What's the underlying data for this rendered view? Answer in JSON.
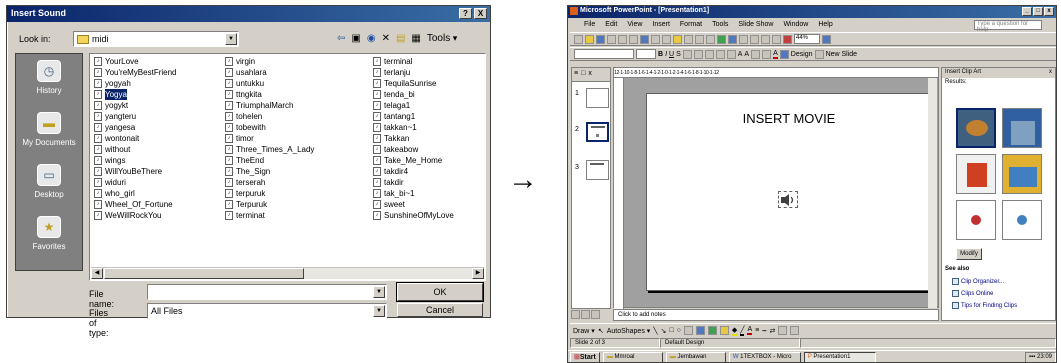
{
  "dialog": {
    "title": "Insert Sound",
    "look_in_label": "Look in:",
    "look_in_value": "midi",
    "tools_label": "Tools",
    "places": [
      {
        "label": "History",
        "icon": "history-icon"
      },
      {
        "label": "My Documents",
        "icon": "my-documents-icon"
      },
      {
        "label": "Desktop",
        "icon": "desktop-icon"
      },
      {
        "label": "Favorites",
        "icon": "favorites-icon"
      }
    ],
    "files_col1": [
      "YourLove",
      "You'reMyBestFriend",
      "yogyah",
      "Yogya",
      "yogykt",
      "yangteru",
      "yangesa",
      "wontonait",
      "without",
      "wings",
      "WillYouBeThere",
      "widuri",
      "who_girl",
      "Wheel_Of_Fortune",
      "WeWillRockYou"
    ],
    "files_col2": [
      "virgin",
      "usahlara",
      "untukku",
      "ttngkita",
      "TriumphalMarch",
      "tohelen",
      "tobewith",
      "timor",
      "Three_Times_A_Lady",
      "TheEnd",
      "The_Sign",
      "terserah",
      "terpuruk",
      "Terpuruk",
      "terminat"
    ],
    "files_col3": [
      "terminal",
      "terlanju",
      "TequilaSunrise",
      "tenda_bi",
      "telaga1",
      "tantang1",
      "takkan~1",
      "Takkan",
      "takeabow",
      "Take_Me_Home",
      "takdir4",
      "takdir",
      "tak_bi~1",
      "sweet",
      "SunshineOfMyLove"
    ],
    "selected_file": "Yogya",
    "file_name_label": "File name:",
    "file_name_value": "",
    "files_of_type_label": "Files of type:",
    "files_of_type_value": "All Files",
    "ok_label": "OK",
    "cancel_label": "Cancel",
    "help_btn": "?",
    "close_btn": "X"
  },
  "arrow": "→",
  "ppt": {
    "title": "Microsoft PowerPoint - [Presentation1]",
    "menu": [
      "File",
      "Edit",
      "View",
      "Insert",
      "Format",
      "Tools",
      "Slide Show",
      "Window",
      "Help"
    ],
    "ask_placeholder": "Type a question for help",
    "zoom": "44%",
    "design_label": "Design",
    "new_slide_label": "New Slide",
    "slide_title": "INSERT MOVIE",
    "slide_numbers": [
      "1",
      "2",
      "3"
    ],
    "notes_placeholder": "Click to add notes",
    "ruler_text": "12·1·10·1·8·1·6·1·4·1·2·1·0·1·2·1·4·1·6·1·8·1·10·1·12",
    "draw_label": "Draw",
    "autoshapes_label": "AutoShapes",
    "status_slide": "Slide 2 of 3",
    "status_design": "Default Design",
    "pane_title": "Insert Clip Art",
    "results_label": "Results:",
    "modify_label": "Modify",
    "see_also_label": "See also",
    "links": [
      "Clip Organizer...",
      "Clips Online",
      "Tips for Finding Clips"
    ],
    "taskbar": {
      "start": "Start",
      "items": [
        "Mmroal",
        "Jembawan",
        "1TEXTBOX - Micro",
        "Presentation1"
      ],
      "clock": "23:09"
    }
  }
}
